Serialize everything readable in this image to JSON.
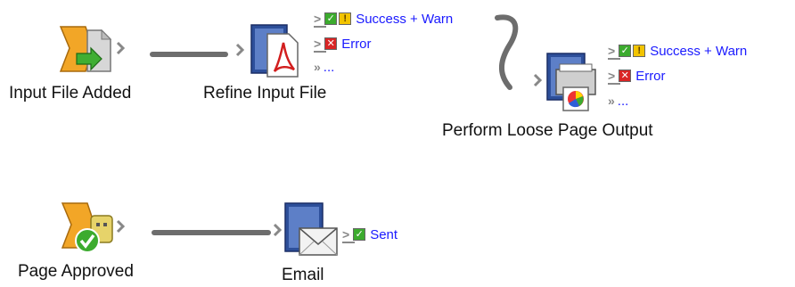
{
  "nodes": {
    "input_file_added": {
      "label": "Input File Added"
    },
    "refine_input_file": {
      "label": "Refine Input File"
    },
    "perform_loose_page_output": {
      "label": "Perform Loose Page Output"
    },
    "page_approved": {
      "label": "Page Approved"
    },
    "email": {
      "label": "Email"
    }
  },
  "ports": {
    "refine": {
      "success_warn": "Success + Warn",
      "error": "Error",
      "more": "..."
    },
    "perform": {
      "success_warn": "Success + Warn",
      "error": "Error",
      "more": "..."
    },
    "email": {
      "sent": "Sent"
    }
  },
  "icons": {
    "ok_glyph": "✓",
    "warn_glyph": "!",
    "err_glyph": "✕"
  },
  "colors": {
    "link": "#1a1aff",
    "connector": "#6d6d6d",
    "success": "#3cab2e",
    "warning": "#f2c400",
    "error": "#d92525"
  }
}
